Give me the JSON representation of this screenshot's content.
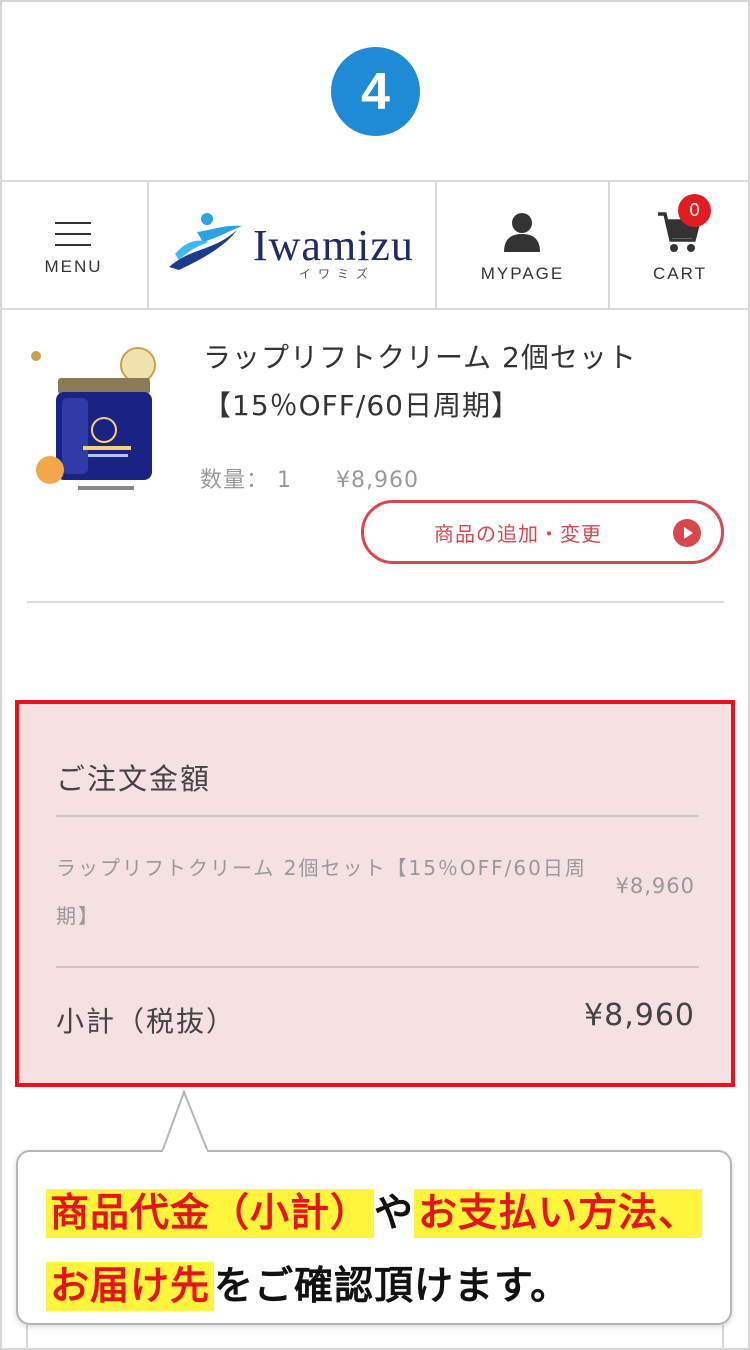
{
  "step_number": "4",
  "header": {
    "menu_label": "MENU",
    "logo_text": "Iwamizu",
    "logo_sub": "イワミズ",
    "mypage_label": "MYPAGE",
    "cart_label": "CART",
    "cart_count": "0"
  },
  "product": {
    "title_line1": "ラップリフトクリーム 2個セット",
    "title_line2": "【15％OFF/60日周期】",
    "qty_label": "数量： 1",
    "price": "¥8,960",
    "change_button": "商品の追加・変更"
  },
  "summary": {
    "title": "ご注文金額",
    "item_name": "ラップリフトクリーム 2個セット【15％OFF/60日周期】",
    "item_price": "¥8,960",
    "subtotal_label": "小計（税抜）",
    "subtotal_value": "¥8,960"
  },
  "callout": {
    "line1_part1": "商品代金（小計）",
    "line1_part2": "や",
    "line1_part3": "お支払い方法、",
    "line2_part1": "お届け先",
    "line2_part2": "をご確認頂けます。"
  },
  "colors": {
    "accent_blue": "#1f8ad6",
    "accent_red": "#e8131a",
    "summary_bg": "#f5e0e2",
    "highlight_yellow": "#fff53a"
  }
}
